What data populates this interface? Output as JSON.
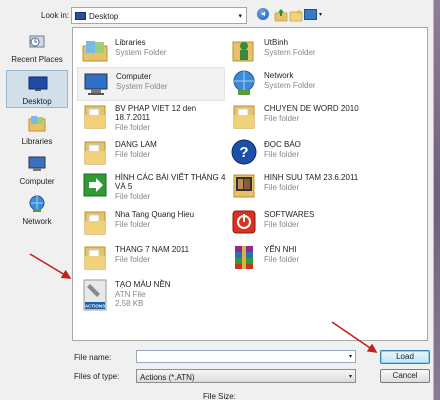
{
  "dialog": {
    "look_in_label": "Look in:",
    "look_in_value": "Desktop",
    "dropdown_glyph": "▾"
  },
  "places": [
    {
      "label": "Recent Places",
      "icon": "recent-places-icon"
    },
    {
      "label": "Desktop",
      "icon": "desktop-icon",
      "selected": true
    },
    {
      "label": "Libraries",
      "icon": "libraries-icon"
    },
    {
      "label": "Computer",
      "icon": "computer-icon"
    },
    {
      "label": "Network",
      "icon": "network-icon"
    }
  ],
  "files": [
    {
      "name": "Libraries",
      "type": "System Folder",
      "icon": "libraries-icon"
    },
    {
      "name": "UtBinh",
      "type": "System Folder",
      "icon": "user-folder-icon"
    },
    {
      "name": "Computer",
      "type": "System Folder",
      "icon": "computer-icon",
      "hot": true
    },
    {
      "name": "Network",
      "type": "System Folder",
      "icon": "network-icon"
    },
    {
      "name": "BV PHAP VIET 12 den 18.7.2011",
      "type": "File folder",
      "icon": "folder-icon"
    },
    {
      "name": "CHUYEN DE WORD 2010",
      "type": "File folder",
      "icon": "folder-icon"
    },
    {
      "name": "DANG LAM",
      "type": "File folder",
      "icon": "folder-icon"
    },
    {
      "name": "ĐỌC BÁO",
      "type": "File folder",
      "icon": "help-icon"
    },
    {
      "name": "HÌNH CÁC BÀI VIẾT THÁNG 4 VÀ 5",
      "type": "File folder",
      "icon": "green-arrow-icon"
    },
    {
      "name": "HINH SUU TAM 23.6.2011",
      "type": "File folder",
      "icon": "film-folder-icon"
    },
    {
      "name": "Nha Tang Quang Hieu",
      "type": "File folder",
      "icon": "folder-icon"
    },
    {
      "name": "SOFTWARES",
      "type": "File folder",
      "icon": "power-icon"
    },
    {
      "name": "THANG 7 NAM 2011",
      "type": "File folder",
      "icon": "folder-icon"
    },
    {
      "name": "YẾN NHI",
      "type": "File folder",
      "icon": "winrar-icon"
    },
    {
      "name": "TẠO MÀU NỀN",
      "type": "ATN File",
      "size": "2.58 KB",
      "icon": "actions-file-icon"
    }
  ],
  "bottom": {
    "file_name_label": "File name:",
    "file_name_value": "",
    "files_of_type_label": "Files of type:",
    "files_of_type_value": "Actions (*.ATN)",
    "load_button": "Load",
    "cancel_button": "Cancel",
    "file_size_label": "File Size:"
  },
  "colors": {
    "annotation_arrow": "#c0221f"
  }
}
